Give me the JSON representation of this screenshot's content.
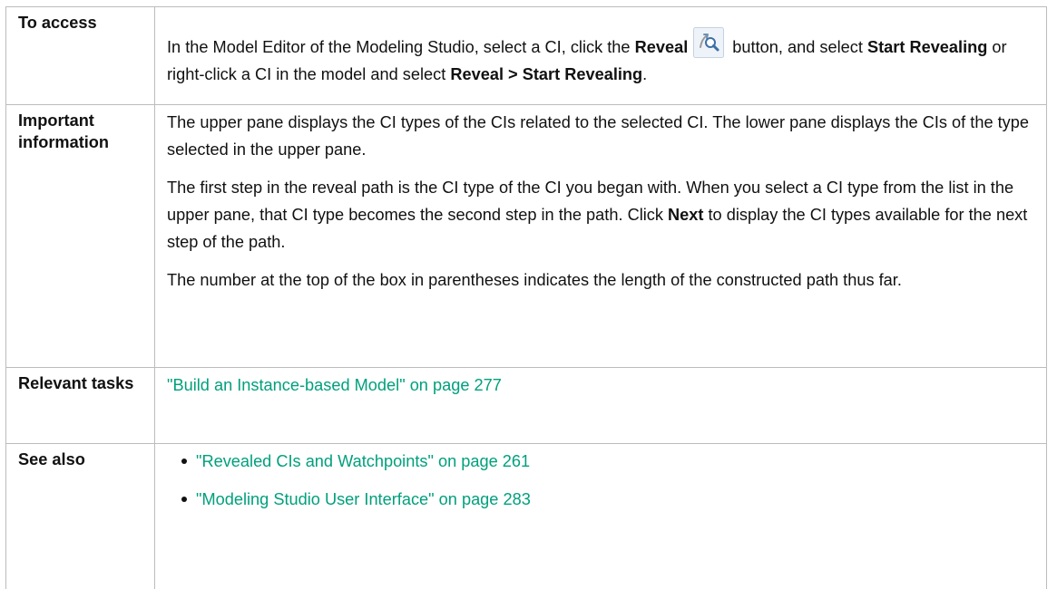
{
  "rows": {
    "access": {
      "label": "To access",
      "text_1": "In the Model Editor of the Modeling Studio, select a CI, click the ",
      "reveal_bold": "Reveal",
      "reveal_icon": "reveal-icon",
      "text_2": " button, and select ",
      "start_revealing_bold": "Start Revealing",
      "text_3": " or right-click a CI in the model and select ",
      "menu_path_bold": "Reveal > Start Revealing",
      "text_4": "."
    },
    "important": {
      "label": "Important information",
      "para_1": "The upper pane displays the CI types of the CIs related to the selected CI. The lower pane displays the CIs of the type selected in the upper pane.",
      "para_2_a": "The first step in the reveal path is the CI type of the CI you began with. When you select a CI type from the list in the upper pane, that CI type becomes the second step in the path. Click ",
      "para_2_bold": "Next",
      "para_2_b": " to display the CI types available for the next step of the path.",
      "para_3": "The number at the top of the box in parentheses indicates the length of the constructed path thus far."
    },
    "tasks": {
      "label": "Relevant tasks",
      "link": "\"Build an Instance-based Model\" on page 277"
    },
    "see_also": {
      "label": "See also",
      "links": [
        "\"Revealed CIs and Watchpoints\" on page 261",
        "\"Modeling Studio User Interface\" on page 283"
      ]
    }
  },
  "colors": {
    "link": "#00a07c",
    "border": "#bcbcbc",
    "text": "#111111"
  }
}
